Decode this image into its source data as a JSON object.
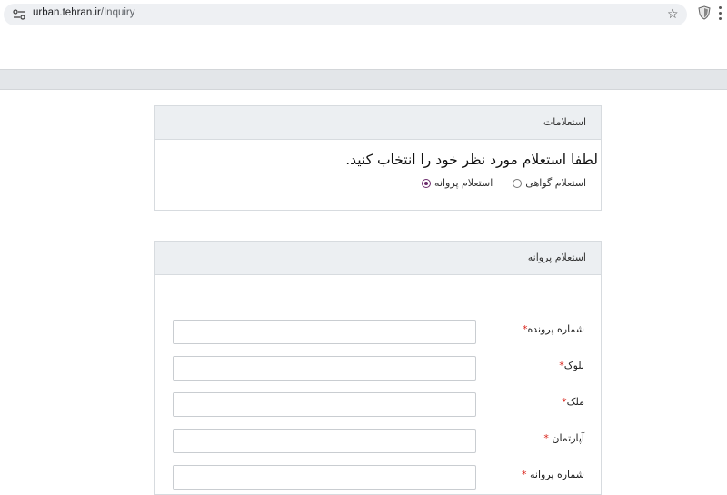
{
  "browser": {
    "url_host": "urban.tehran.ir",
    "url_path": "/Inquiry",
    "star_icon": "☆"
  },
  "panel_inquiries": {
    "heading": "استعلامات",
    "prompt": "لطفا استعلام مورد نظر خود را انتخاب کنید.",
    "options": [
      {
        "label": "استعلام گواهی",
        "checked": false
      },
      {
        "label": "استعلام پروانه",
        "checked": true
      }
    ]
  },
  "panel_permit": {
    "heading": "استعلام پروانه",
    "fields": [
      {
        "label": "شماره پرونده",
        "required_mark": "*",
        "value": ""
      },
      {
        "label": "بلوک",
        "required_mark": "*",
        "value": ""
      },
      {
        "label": "ملک",
        "required_mark": "*",
        "value": ""
      },
      {
        "label": "آپارتمان",
        "required_mark": " *",
        "value": ""
      },
      {
        "label": "شماره پروانه",
        "required_mark": " *",
        "value": ""
      }
    ]
  },
  "colors": {
    "heading_bg": "#eceff2",
    "nav_strip": "#e3e6e9",
    "radio_accent": "#6b2a6b",
    "required": "#d9241b"
  }
}
